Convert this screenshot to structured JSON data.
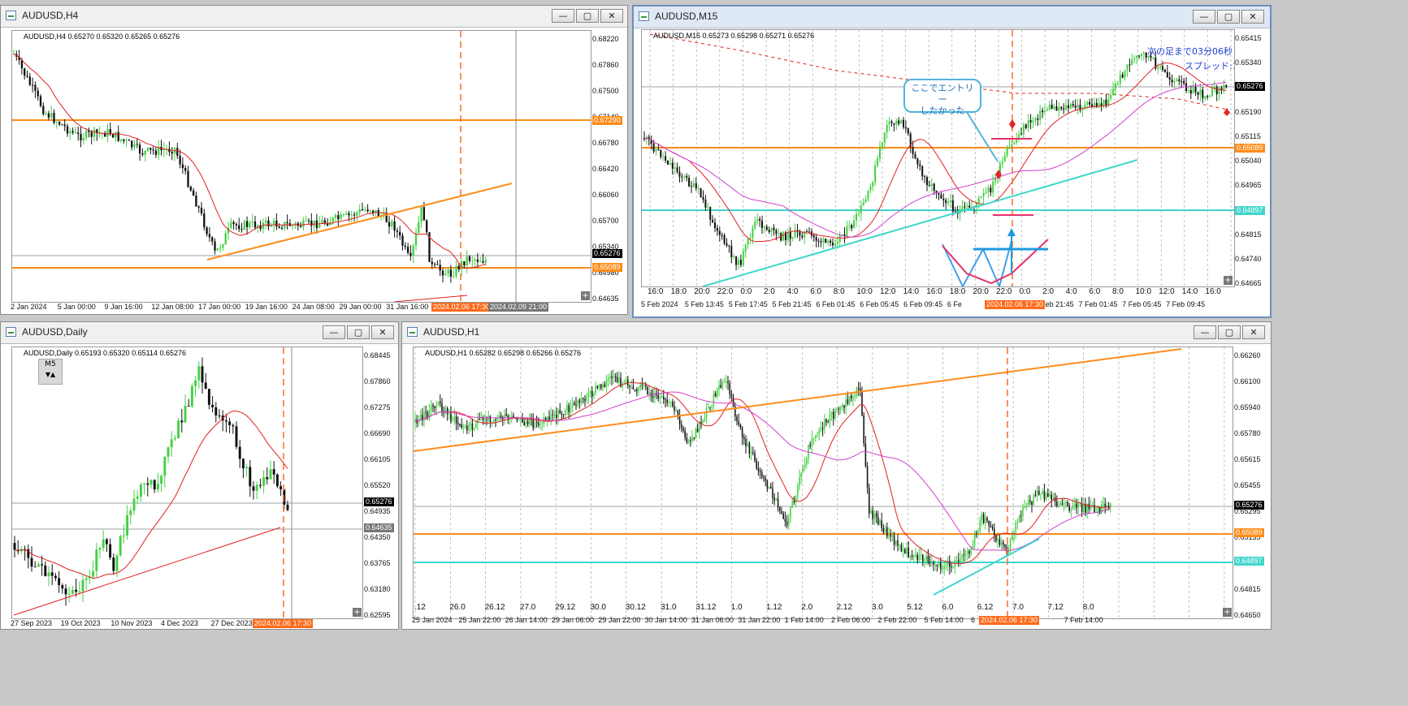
{
  "windows": {
    "h4": {
      "title": "AUDUSD,H4",
      "header": "AUDUSD,H4  0.65270 0.65320 0.65265 0.65276",
      "prices": [
        "0.68220",
        "0.67860",
        "0.67500",
        "0.67140",
        "0.66780",
        "0.66420",
        "0.66060",
        "0.65700",
        "0.65340",
        "0.64980",
        "0.64635"
      ],
      "tags": {
        "bid": "0.65276",
        "upper_line": "0.67290",
        "lower_line": "0.65089"
      },
      "times": [
        "2 Jan 2024",
        "5 Jan 00:00",
        "9 Jan 16:00",
        "12 Jan 08:00",
        "17 Jan 00:00",
        "19 Jan 16:00",
        "24 Jan 08:00",
        "29 Jan 00:00",
        "31 Jan 16:00"
      ],
      "cursor_time": "2024.02.06 17:30",
      "cursor_time2": "2024.02.09 21:00"
    },
    "m15": {
      "title": "AUDUSD,M15",
      "header": "AUDUSD,M15  0.65273 0.65298 0.65271 0.65276",
      "prices": [
        "0.65415",
        "0.65340",
        "0.65265",
        "0.65190",
        "0.65115",
        "0.65040",
        "0.64965",
        "0.64890",
        "0.64815",
        "0.64740",
        "0.64665"
      ],
      "tags": {
        "bid": "0.65276",
        "orange": "0.65089",
        "cyan": "0.64897"
      },
      "hours": [
        "16:0",
        "18:0",
        "20:0",
        "22:0",
        "0:0",
        "2:0",
        "4:0",
        "6:0",
        "8:0",
        "10:0",
        "12:0",
        "14:0",
        "16:0",
        "18:0",
        "20:0",
        "22:0",
        "0:0",
        "2:0",
        "4:0",
        "6:0",
        "8:0",
        "10:0",
        "12:0",
        "14:0",
        "16:0"
      ],
      "times": [
        "5 Feb 2024",
        "5 Feb 13:45",
        "5 Feb 17:45",
        "5 Feb 21:45",
        "6 Feb 01:45",
        "6 Feb 05:45",
        "6 Feb 09:45",
        "6 Fe",
        "2:45",
        "6 Feb 21:45",
        "7 Feb 01:45",
        "7 Feb 05:45",
        "7 Feb 09:45"
      ],
      "cursor_time": "2024.02.06 17:30",
      "callout": [
        "ここでエントリー",
        "したかった"
      ],
      "countdown_line1": "次の足まで03分06秒",
      "countdown_line2": "スプレッド:1"
    },
    "daily": {
      "title": "AUDUSD,Daily",
      "header": "AUDUSD,Daily  0.65193 0.65320 0.65114 0.65276",
      "m5_label": "M5",
      "prices": [
        "0.68445",
        "0.67860",
        "0.67275",
        "0.66690",
        "0.66105",
        "0.65520",
        "0.64935",
        "0.64350",
        "0.63765",
        "0.63180",
        "0.62595"
      ],
      "tags": {
        "bid": "0.65276",
        "low": "0.64635"
      },
      "times": [
        "27 Sep 2023",
        "19 Oct 2023",
        "10 Nov 2023",
        "4 Dec 2023",
        "27 Dec 2023",
        "15"
      ],
      "cursor_time": "2024.02.06 17:30"
    },
    "h1": {
      "title": "AUDUSD,H1",
      "header": "AUDUSD,H1  0.65282 0.65298 0.65266 0.65276",
      "prices": [
        "0.66260",
        "0.66100",
        "0.65940",
        "0.65780",
        "0.65615",
        "0.65455",
        "0.65295",
        "0.65135",
        "0.64975",
        "0.64815",
        "0.64650"
      ],
      "tags": {
        "bid": "0.65276",
        "orange": "0.65089",
        "cyan": "0.64897"
      },
      "days": [
        ".12",
        "26.0",
        "26.12",
        "27.0",
        "29.12",
        "30.0",
        "30.12",
        "31.0",
        "31.12",
        "1.0",
        "1.12",
        "2.0",
        "2.12",
        "3.0",
        "5.12",
        "6.0",
        "6.12",
        "7.0",
        "7.12",
        "8.0"
      ],
      "times": [
        "25 Jan 2024",
        "25 Jan 22:00",
        "26 Jan 14:00",
        "29 Jan 06:00",
        "29 Jan 22:00",
        "30 Jan 14:00",
        "31 Jan 06:00",
        "31 Jan 22:00",
        "1 Feb 14:00",
        "2 Feb 06:00",
        "2 Feb 22:00",
        "5 Feb 14:00",
        "6",
        "22:00",
        "7 Feb 14:00"
      ],
      "cursor_time": "2024.02.06 17:30"
    }
  },
  "buttons": {
    "minimize": "—",
    "maximize": "▢",
    "close": "✕"
  },
  "colors": {
    "bull": "#43d143",
    "bear": "#111111",
    "ma_red": "#e02020",
    "ma_magenta": "#d040d0",
    "orange": "#ff8c1a",
    "cyan": "#3fd6cc",
    "cursor": "#ff6a2a",
    "tag_orange": "#ff6a1a",
    "tag_dark": "#000000"
  }
}
